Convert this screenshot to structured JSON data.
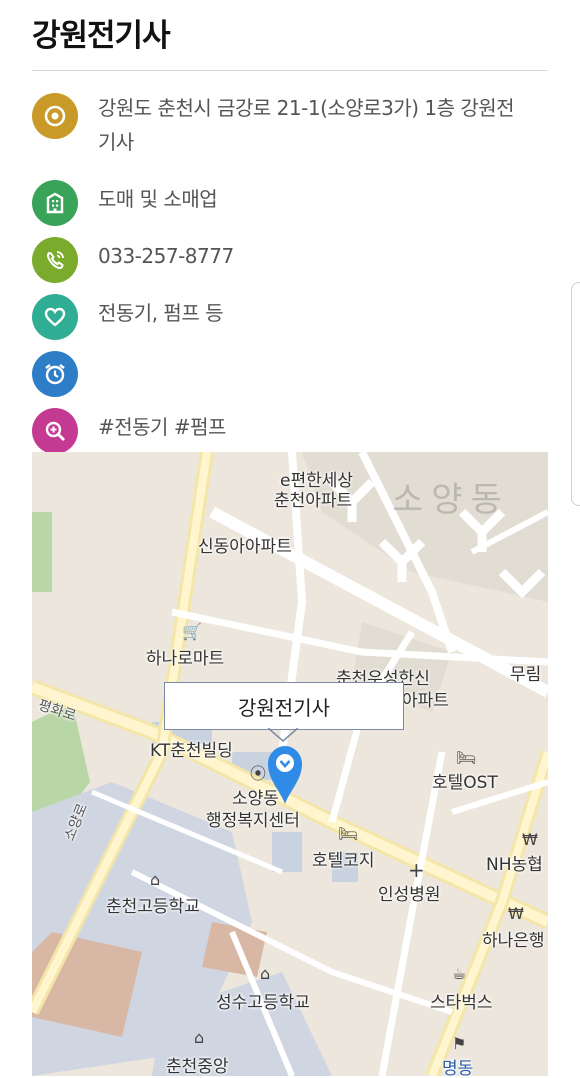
{
  "business": {
    "name": "강원전기사"
  },
  "details": {
    "address": "강원도 춘천시 금강로 21-1(소양로3가) 1층 강원전",
    "address_cont": "기사",
    "category": "도매 및 소매업",
    "phone": "033-257-8777",
    "services": "전동기, 펌프 등",
    "hours": "",
    "tags": "#전동기 #펌프"
  },
  "colors": {
    "address_icon": "#c99a28",
    "category_icon": "#3aa35a",
    "phone_icon": "#7aab2d",
    "services_icon": "#2fae94",
    "hours_icon": "#2d7dc7",
    "tags_icon": "#c43a93",
    "marker": "#2f8be6"
  },
  "map": {
    "callout": "강원전기사",
    "labels": {
      "apt1_a": "e편한세상",
      "apt1_b": "춘천아파트",
      "district": "소양동",
      "apt2": "신동아아파트",
      "mart": "하나로마트",
      "apt3_a": "춘천우성한신",
      "apt3_b": "아파트",
      "murim": "무림",
      "road1": "평화로",
      "kt": "KT춘천빌딩",
      "center_a": "소양동",
      "center_b": "행정복지센터",
      "hotel_ost": "호텔OST",
      "hotel_kozi": "호텔코지",
      "nh": "NH농협",
      "hospital": "인성병원",
      "school1": "춘천고등학교",
      "hana": "하나은행",
      "road2": "소양로",
      "school2": "성수고등학교",
      "starbucks": "스타벅스",
      "middle": "춘천중앙",
      "myeongdong": "명동"
    }
  }
}
